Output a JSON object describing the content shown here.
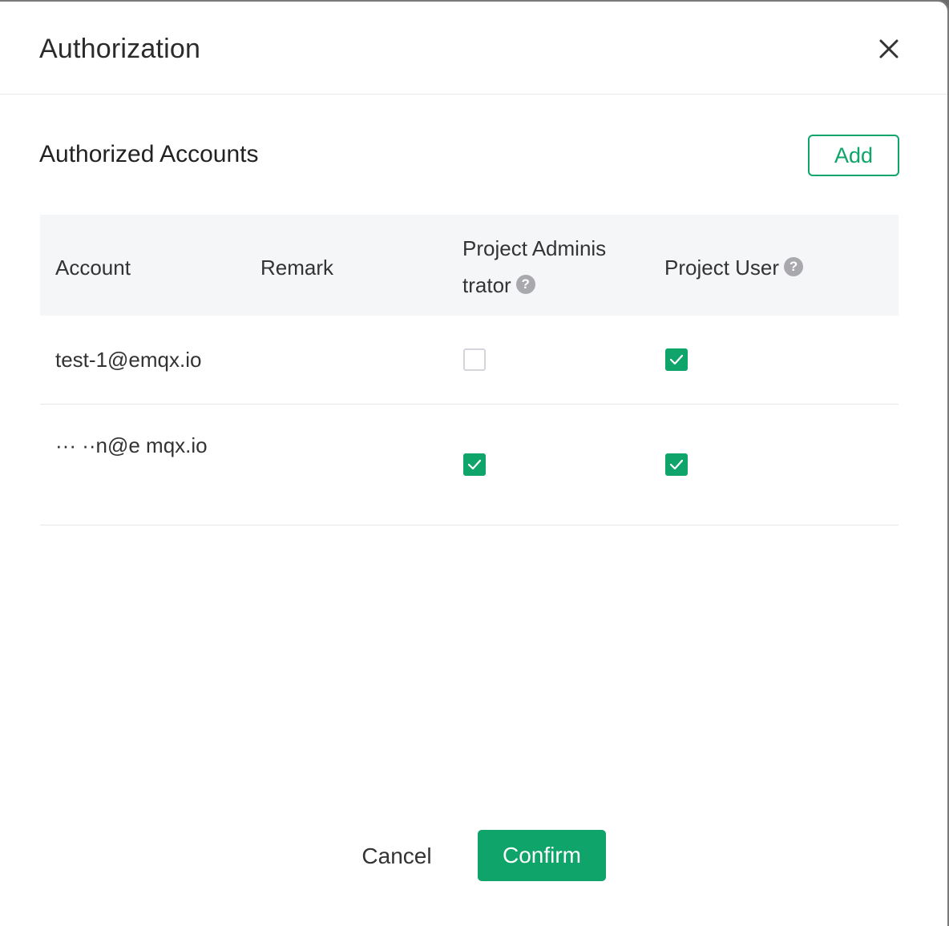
{
  "dialog": {
    "title": "Authorization",
    "close_icon": "close-icon"
  },
  "section": {
    "title": "Authorized Accounts",
    "add_label": "Add"
  },
  "table": {
    "columns": {
      "account": "Account",
      "remark": "Remark",
      "admin": "Project Adminis trator",
      "user": "Project User"
    },
    "help_icon": "help-icon",
    "rows": [
      {
        "account": "test-1@emqx.io",
        "remark": "",
        "project_administrator": false,
        "project_user": true
      },
      {
        "account": "··· ··n@e mqx.io",
        "remark": "",
        "project_administrator": true,
        "project_user": true
      }
    ]
  },
  "footer": {
    "cancel_label": "Cancel",
    "confirm_label": "Confirm"
  },
  "colors": {
    "accent": "#0ea46a",
    "header_bg": "#f5f6f8",
    "text": "#333333",
    "help_icon": "#a9a9ad"
  }
}
